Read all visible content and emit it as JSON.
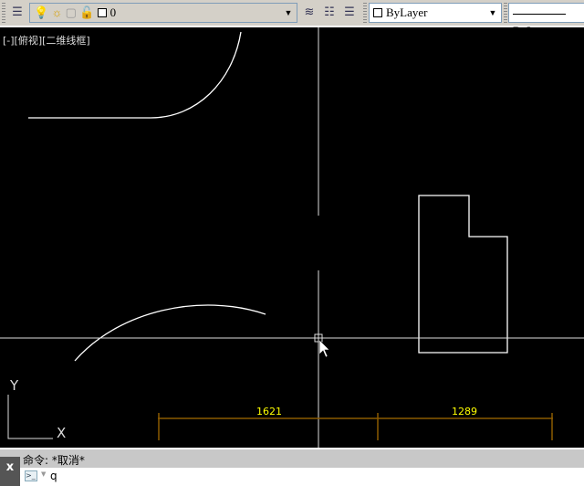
{
  "toolbar": {
    "layer_name": "0",
    "color_value": "ByLayer",
    "linetype_value": "ByL",
    "icons": [
      "layer-properties-icon",
      "bulb-icon",
      "sun-icon",
      "freeze-viewport-icon",
      "lock-icon",
      "make-current-icon",
      "layer-previous-icon",
      "layer-states-icon"
    ]
  },
  "viewport": {
    "label": "[-][俯视][二维线框]"
  },
  "ucs": {
    "x_label": "X",
    "y_label": "Y"
  },
  "dimensions": [
    {
      "text": "1621"
    },
    {
      "text": "1289"
    }
  ],
  "colors": {
    "dimension_line": "#8b5a00",
    "dimension_text": "#ffff00",
    "geometry": "#ffffff",
    "background": "#000000"
  },
  "command": {
    "history": "命令:  *取消*",
    "input": "q",
    "close_label": "x"
  }
}
